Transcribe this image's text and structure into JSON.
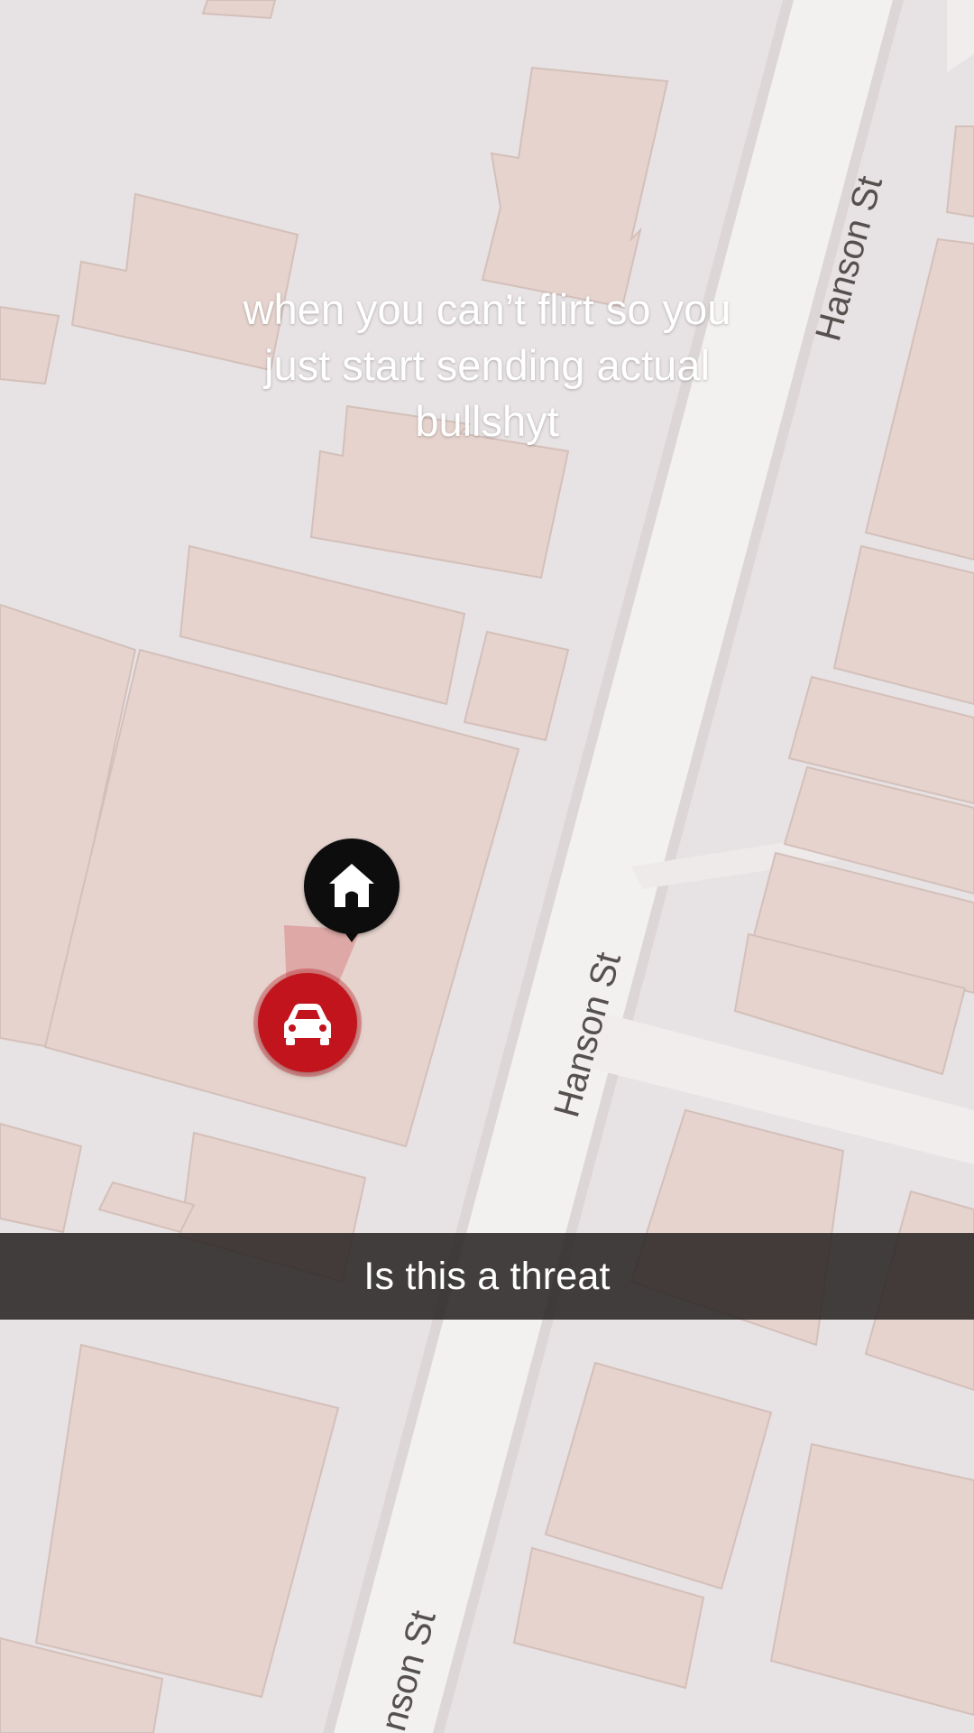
{
  "map": {
    "street_labels": [
      "Hanson St",
      "Hanson St",
      "nson St"
    ]
  },
  "overlay": {
    "caption_lines": [
      "when you can’t flirt so you",
      "just start sending actual",
      "bullshyt"
    ]
  },
  "caption_bar": {
    "text": "Is this a threat"
  },
  "markers": {
    "home_icon": "home-icon",
    "car_icon": "car-icon",
    "home_color": "#0d0d0d",
    "car_color": "#c1141c"
  },
  "colors": {
    "map_background": "#e7e2e3",
    "building_fill": "#e6d3cd",
    "road_fill": "#f3f0f0"
  }
}
